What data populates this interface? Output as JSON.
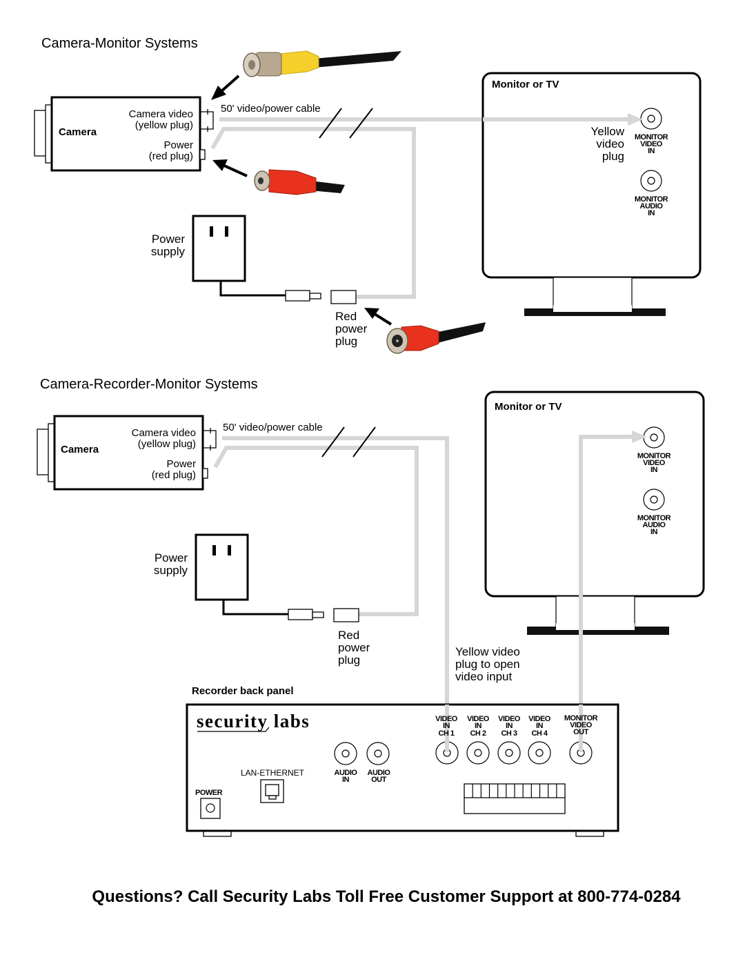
{
  "section1": {
    "title": "Camera-Monitor Systems",
    "camera": {
      "name": "Camera",
      "video_label_1": "Camera video",
      "video_label_2": "(yellow plug)",
      "power_label_1": "Power",
      "power_label_2": "(red plug)"
    },
    "cable_label": "50' video/power cable",
    "monitor": {
      "title": "Monitor or TV",
      "plug_label": [
        "Yellow",
        "video",
        "plug"
      ],
      "video_in": [
        "MONITOR",
        "VIDEO",
        "IN"
      ],
      "audio_in": [
        "MONITOR",
        "AUDIO",
        "IN"
      ]
    },
    "power_supply": [
      "Power",
      "supply"
    ],
    "red_power_plug": [
      "Red",
      "power",
      "plug"
    ]
  },
  "section2": {
    "title": "Camera-Recorder-Monitor Systems",
    "camera": {
      "name": "Camera",
      "video_label_1": "Camera video",
      "video_label_2": "(yellow plug)",
      "power_label_1": "Power",
      "power_label_2": "(red plug)"
    },
    "cable_label": "50' video/power cable",
    "monitor": {
      "title": "Monitor or TV",
      "video_in": [
        "MONITOR",
        "VIDEO",
        "IN"
      ],
      "audio_in": [
        "MONITOR",
        "AUDIO",
        "IN"
      ]
    },
    "power_supply": [
      "Power",
      "supply"
    ],
    "red_power_plug": [
      "Red",
      "power",
      "plug"
    ],
    "yellow_note": [
      "Yellow video",
      "plug to open",
      "video input"
    ],
    "recorder": {
      "panel_label": "Recorder back panel",
      "brand": "security labs",
      "power": "POWER",
      "lan": "LAN-ETHERNET",
      "audio_in": [
        "AUDIO",
        "IN"
      ],
      "audio_out": [
        "AUDIO",
        "OUT"
      ],
      "channels": [
        [
          "VIDEO",
          "IN",
          "CH 1"
        ],
        [
          "VIDEO",
          "IN",
          "CH 2"
        ],
        [
          "VIDEO",
          "IN",
          "CH 3"
        ],
        [
          "VIDEO",
          "IN",
          "CH 4"
        ]
      ],
      "monitor_out": [
        "MONITOR",
        "VIDEO",
        "OUT"
      ]
    }
  },
  "footer": "Questions? Call Security Labs Toll Free Customer Support at 800-774-0284",
  "colors": {
    "cable": "#d6d6d6",
    "yellow_plug": "#f5d02a",
    "red_plug": "#e8321e",
    "connector_metal": "#b8a890"
  }
}
